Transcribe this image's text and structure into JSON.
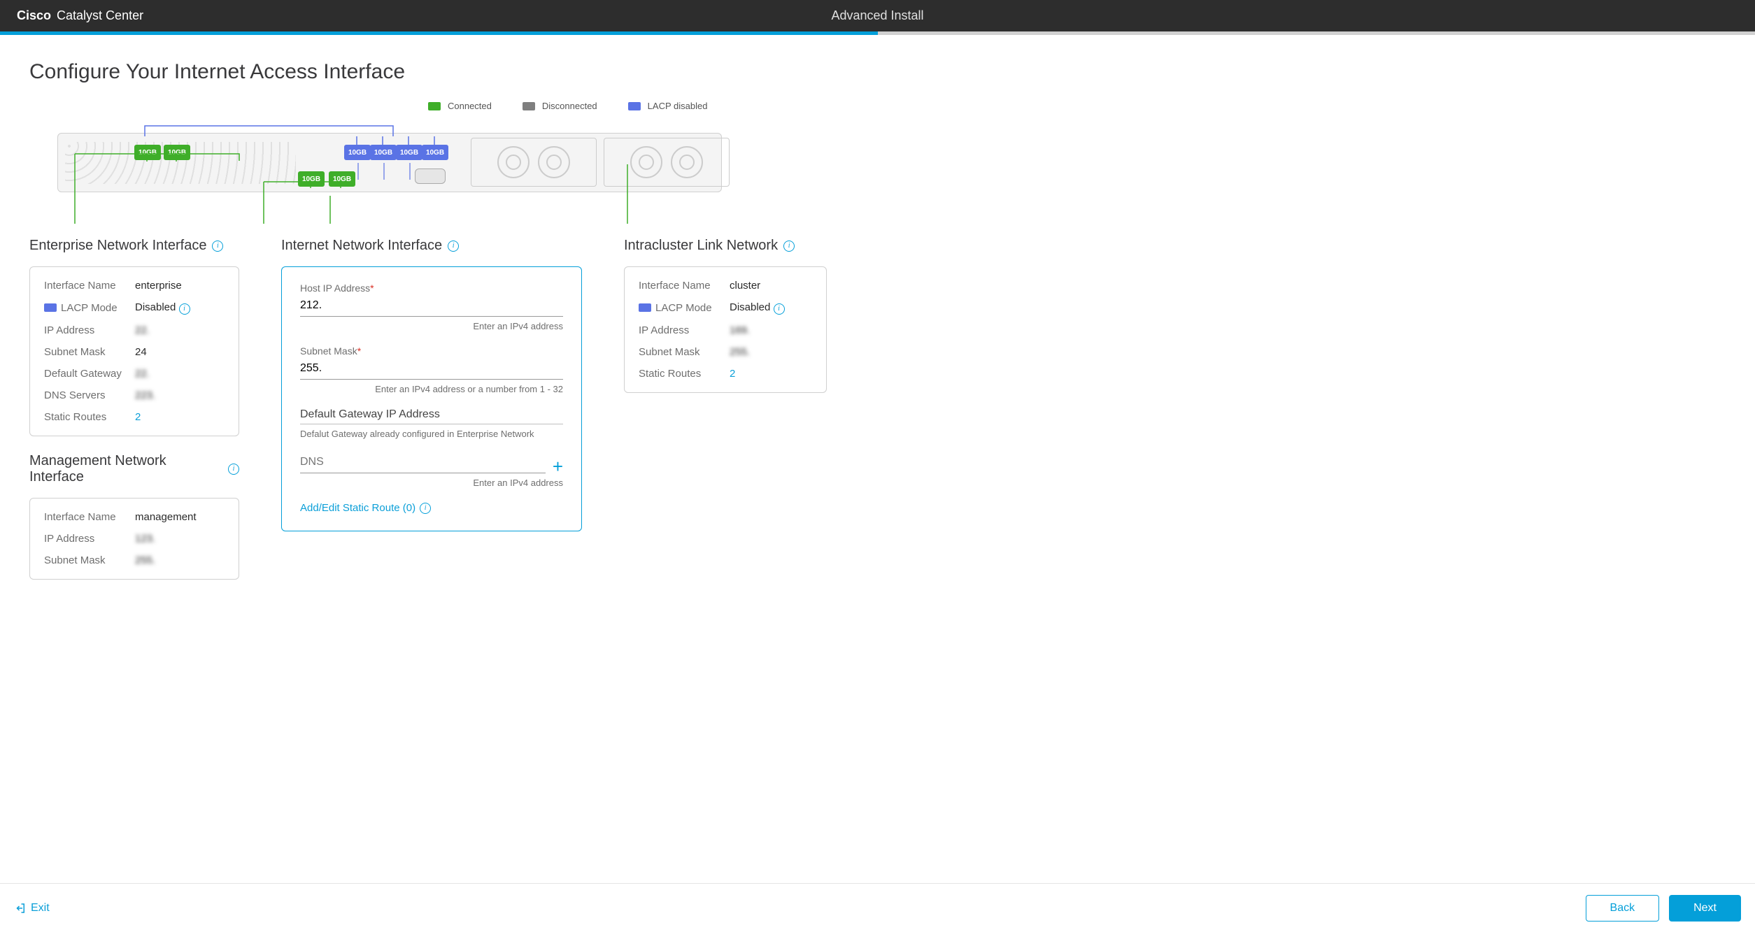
{
  "header": {
    "brand_bold": "Cisco",
    "brand_rest": "Catalyst Center",
    "title": "Advanced Install",
    "progress_percent": 50
  },
  "page_title": "Configure Your Internet Access Interface",
  "legend": {
    "connected": "Connected",
    "disconnected": "Disconnected",
    "lacp_disabled": "LACP disabled"
  },
  "port_label": "10GB",
  "enterprise": {
    "title": "Enterprise Network Interface",
    "rows": {
      "interface_name_k": "Interface Name",
      "interface_name_v": "enterprise",
      "lacp_mode_k": "LACP Mode",
      "lacp_mode_v": "Disabled",
      "ip_k": "IP Address",
      "ip_v": "22.",
      "subnet_k": "Subnet Mask",
      "subnet_v": "24",
      "gw_k": "Default Gateway",
      "gw_v": "22.",
      "dns_k": "DNS Servers",
      "dns_v": "223.",
      "routes_k": "Static Routes",
      "routes_v": "2"
    }
  },
  "management": {
    "title": "Management Network Interface",
    "rows": {
      "interface_name_k": "Interface Name",
      "interface_name_v": "management",
      "ip_k": "IP Address",
      "ip_v": "123.",
      "subnet_k": "Subnet Mask",
      "subnet_v": "255."
    }
  },
  "internet": {
    "title": "Internet Network Interface",
    "host_ip_label": "Host IP Address",
    "host_ip_value": "212.",
    "host_ip_hint": "Enter an IPv4 address",
    "subnet_label": "Subnet Mask",
    "subnet_value": "255.",
    "subnet_hint": "Enter an IPv4 address or a number from 1 - 32",
    "gw_label": "Default Gateway IP Address",
    "gw_hint": "Defalut Gateway already configured in Enterprise Network",
    "dns_label": "DNS",
    "dns_hint": "Enter an IPv4 address",
    "static_link": "Add/Edit Static Route (0)"
  },
  "cluster": {
    "title": "Intracluster Link Network",
    "rows": {
      "interface_name_k": "Interface Name",
      "interface_name_v": "cluster",
      "lacp_mode_k": "LACP Mode",
      "lacp_mode_v": "Disabled",
      "ip_k": "IP Address",
      "ip_v": "169.",
      "subnet_k": "Subnet Mask",
      "subnet_v": "255.",
      "routes_k": "Static Routes",
      "routes_v": "2"
    }
  },
  "footer": {
    "exit": "Exit",
    "back": "Back",
    "next": "Next"
  }
}
